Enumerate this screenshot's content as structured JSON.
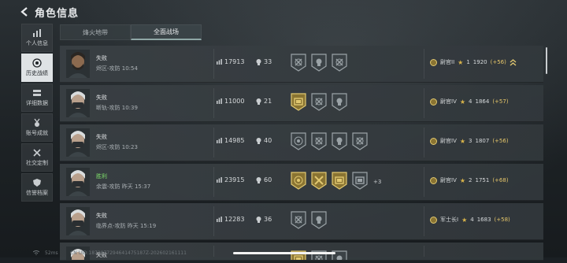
{
  "header": {
    "title": "角色信息"
  },
  "sidebar": {
    "items": [
      {
        "label": "个人信息",
        "icon": "bar-chart-icon"
      },
      {
        "label": "历史战绩",
        "icon": "target-icon",
        "active": true
      },
      {
        "label": "详细数据",
        "icon": "stack-icon"
      },
      {
        "label": "账号成就",
        "icon": "medal-icon"
      },
      {
        "label": "社交定制",
        "icon": "tools-icon"
      },
      {
        "label": "信誉档案",
        "icon": "shield-icon"
      }
    ]
  },
  "tabs": [
    {
      "label": "烽火地带"
    },
    {
      "label": "全面战场",
      "active": true
    }
  ],
  "matches": [
    {
      "result": "失败",
      "map": "烬区-攻防 10:54",
      "score": "17913",
      "kills": "33",
      "medals": [
        "cross",
        "skull",
        "crosshair"
      ],
      "rank": "尉官II",
      "stars": "1",
      "points": "1920",
      "gain": "(+56)",
      "avatar": "#6b5a46"
    },
    {
      "result": "失败",
      "map": "断轨-攻防 10:39",
      "score": "11000",
      "kills": "21",
      "medals": [
        "gold-box",
        "cross",
        "skull"
      ],
      "rank": "尉官IV",
      "stars": "4",
      "points": "1864",
      "gain": "(+57)",
      "avatar": "#8a8f93"
    },
    {
      "result": "失败",
      "map": "烬区-攻防 10:23",
      "score": "14985",
      "kills": "40",
      "medals": [
        "target",
        "cross",
        "skull",
        "crosshair"
      ],
      "rank": "尉官IV",
      "stars": "3",
      "points": "1807",
      "gain": "(+56)",
      "avatar": "#8a8f93"
    },
    {
      "result": "胜利",
      "map": "余震-攻防 昨天 15:37",
      "score": "23915",
      "kills": "60",
      "medals": [
        "gold-target",
        "gold-axes",
        "gold-box",
        "silver-box"
      ],
      "more": "+3",
      "rank": "尉官IV",
      "stars": "2",
      "points": "1751",
      "gain": "(+68)",
      "avatar": "#8a8f93",
      "win": true
    },
    {
      "result": "失败",
      "map": "临界点-攻防 昨天 15:19",
      "score": "12283",
      "kills": "36",
      "medals": [
        "cross",
        "skull"
      ],
      "rank": "军士长I",
      "stars": "4",
      "points": "1683",
      "gain": "(+58)",
      "avatar": "#8a8f93"
    },
    {
      "result": "失败",
      "map": "",
      "score": "",
      "kills": "",
      "medals": [
        "gold-box",
        "cross",
        "skull"
      ],
      "rank": "",
      "stars": "",
      "points": "",
      "gain": "",
      "avatar": "#8a8f93",
      "clipped": true
    }
  ],
  "footer": {
    "ping": "52ms",
    "uid": "CN UID:1872877294641475187Z-202602161111"
  },
  "colors": {
    "win": "#7fe06b",
    "gain": "#e6c66a",
    "star": "#d9b44a"
  }
}
